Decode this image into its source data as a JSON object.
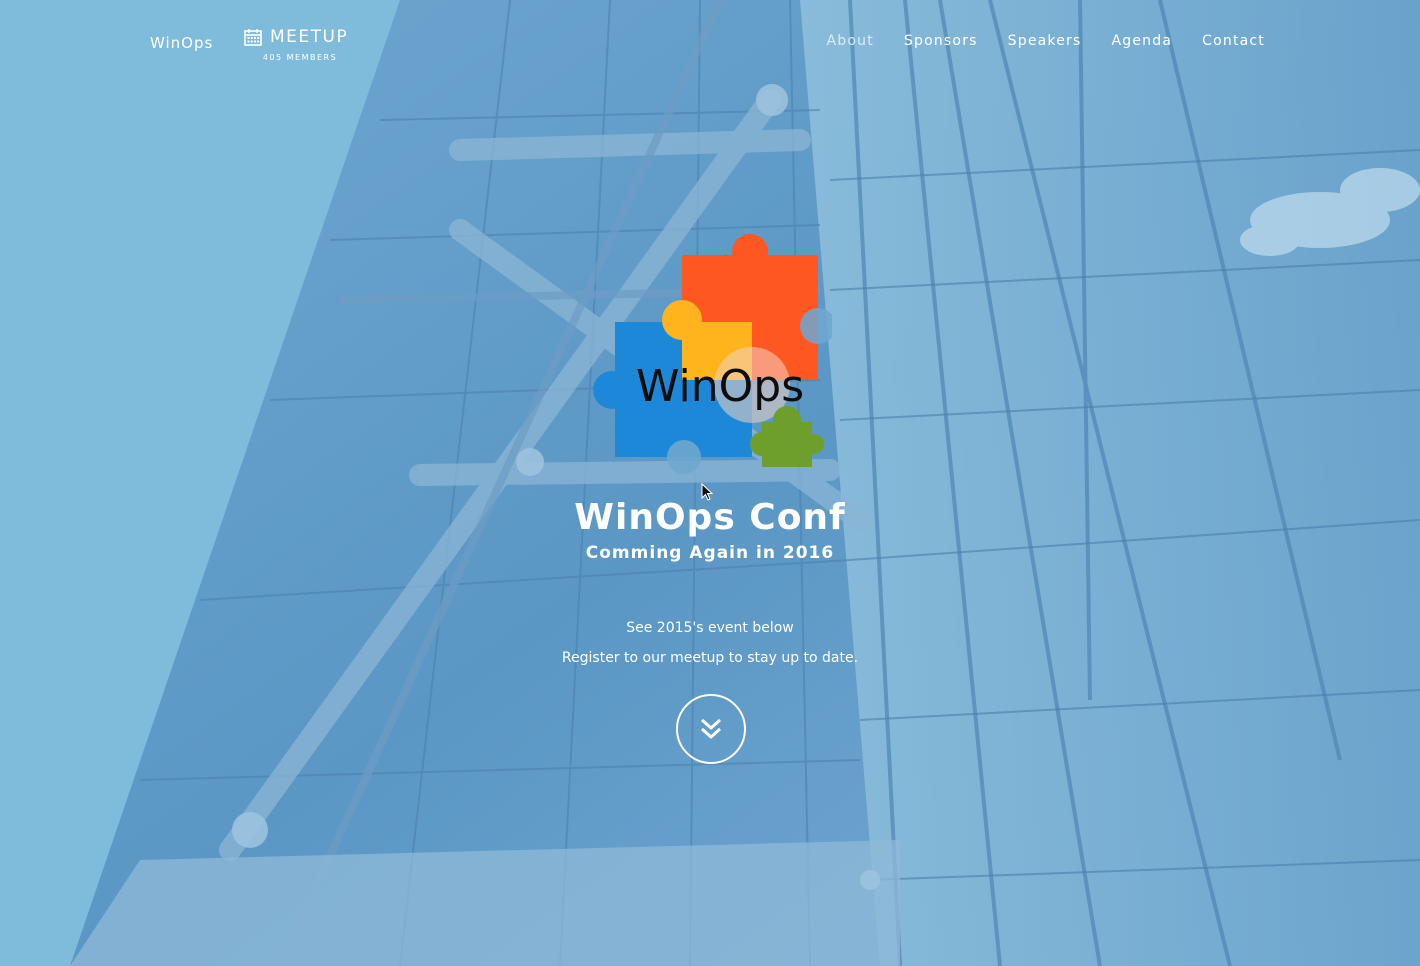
{
  "nav": {
    "brand": "WinOps",
    "meetup_label": "MEETUP",
    "meetup_members": "405 MEMBERS",
    "links": [
      "About",
      "Sponsors",
      "Speakers",
      "Agenda",
      "Contact"
    ]
  },
  "hero": {
    "logo_text": "WinOps",
    "title": "WinOps Conf",
    "subtitle": "Comming Again in 2016",
    "line1": "See 2015's event below",
    "line2": "Register to our meetup to stay up to date."
  },
  "icons": {
    "meetup": "calendar-icon",
    "scroll": "double-chevron-down-icon",
    "cursor": "mouse-pointer-icon"
  },
  "colors": {
    "overlay": "#7fbcdc",
    "puzzle_red": "#ff5722",
    "puzzle_yellow": "#ffb31c",
    "puzzle_blue": "#1e88d8",
    "puzzle_green": "#6e9f2d",
    "text": "#ffffff"
  }
}
